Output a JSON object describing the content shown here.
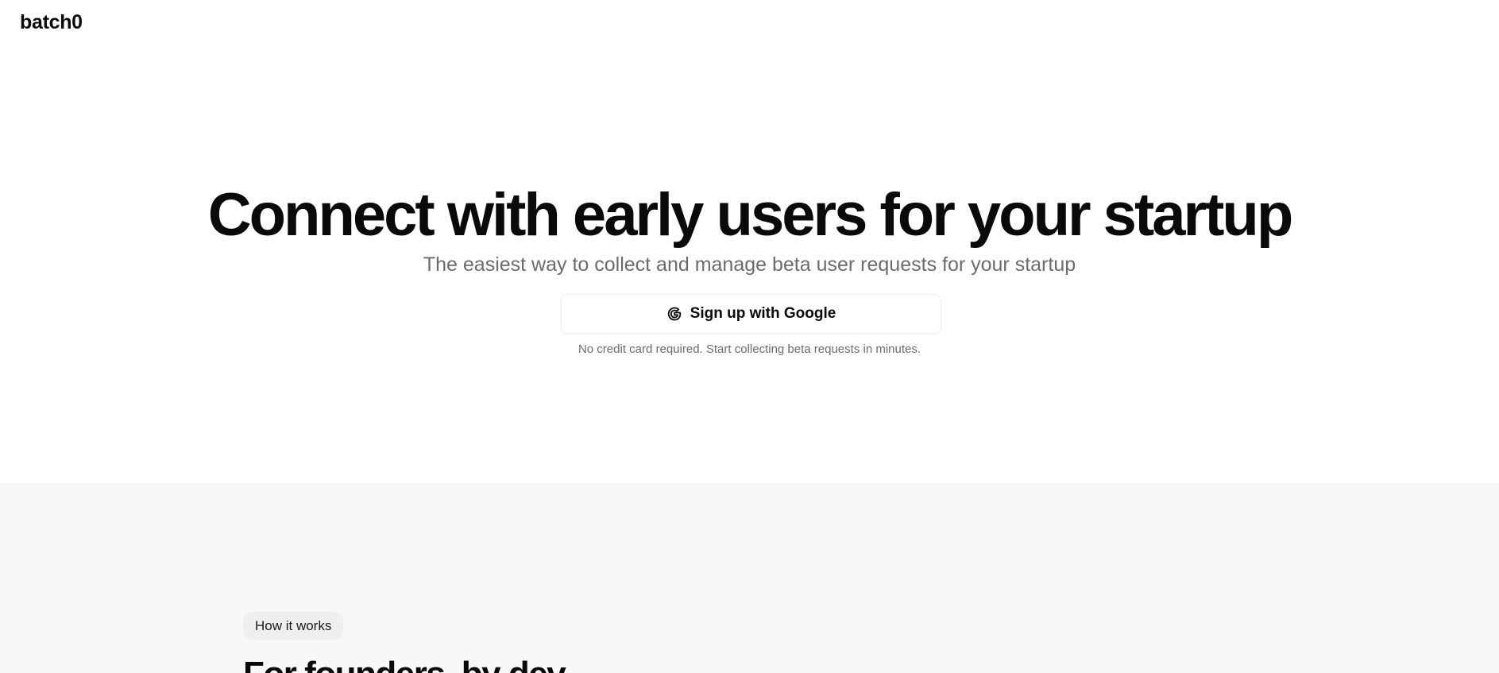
{
  "brand": {
    "logo_text": "batch0"
  },
  "hero": {
    "headline": "Connect with early users for your startup",
    "subheadline": "The easiest way to collect and manage beta user requests for your startup",
    "cta_label": "Sign up with Google",
    "cta_icon": "google-icon",
    "note": "No credit card required. Start collecting beta requests in minutes."
  },
  "how_it_works": {
    "badge": "How it works",
    "title": "For founders, by dev"
  },
  "colors": {
    "text": "#0a0a0a",
    "muted": "#6b6b6b",
    "section_bg": "#f8f8f8",
    "pill_bg": "#efefef"
  }
}
